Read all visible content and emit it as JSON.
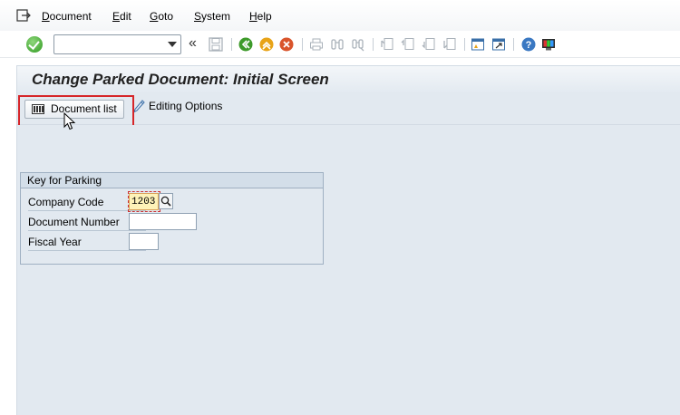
{
  "menu": {
    "items": [
      {
        "accel": "D",
        "rest": "ocument"
      },
      {
        "accel": "E",
        "rest": "dit"
      },
      {
        "accel": "G",
        "rest": "oto"
      },
      {
        "accel": "S",
        "rest": "ystem"
      },
      {
        "accel": "H",
        "rest": "elp"
      }
    ]
  },
  "toolbar": {
    "command_field_value": "",
    "back_glyph": "«"
  },
  "title": "Change Parked Document: Initial Screen",
  "app_toolbar": {
    "document_list_label": "Document list",
    "editing_options_label": "Editing Options"
  },
  "group": {
    "title": "Key for Parking",
    "fields": {
      "company_code": {
        "label": "Company Code",
        "value": "1203"
      },
      "document_number": {
        "label": "Document Number",
        "value": ""
      },
      "fiscal_year": {
        "label": "Fiscal Year",
        "value": ""
      }
    }
  },
  "colors": {
    "highlight": "#d6262a",
    "workarea": "#e2e9f0"
  }
}
